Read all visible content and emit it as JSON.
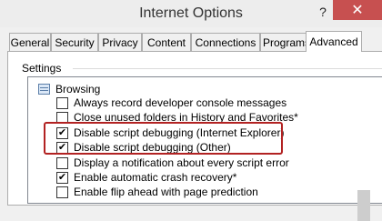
{
  "window": {
    "title": "Internet Options",
    "help_label": "?",
    "close_label": "✕"
  },
  "tabs": [
    {
      "label": "General",
      "active": false
    },
    {
      "label": "Security",
      "active": false
    },
    {
      "label": "Privacy",
      "active": false
    },
    {
      "label": "Content",
      "active": false
    },
    {
      "label": "Connections",
      "active": false
    },
    {
      "label": "Programs",
      "active": false
    },
    {
      "label": "Advanced",
      "active": true
    }
  ],
  "settings": {
    "label": "Settings",
    "group_label": "Browsing",
    "items": [
      {
        "label": "Always record developer console messages",
        "checked": false
      },
      {
        "label": "Close unused folders in History and Favorites*",
        "checked": false
      },
      {
        "label": "Disable script debugging (Internet Explorer)",
        "checked": true
      },
      {
        "label": "Disable script debugging (Other)",
        "checked": true
      },
      {
        "label": "Display a notification about every script error",
        "checked": false
      },
      {
        "label": "Enable automatic crash recovery*",
        "checked": true
      },
      {
        "label": "Enable flip ahead with page prediction",
        "checked": false
      }
    ],
    "check_glyph": "✔"
  },
  "colors": {
    "close_button": "#c75050",
    "highlight_border": "#b22222"
  }
}
